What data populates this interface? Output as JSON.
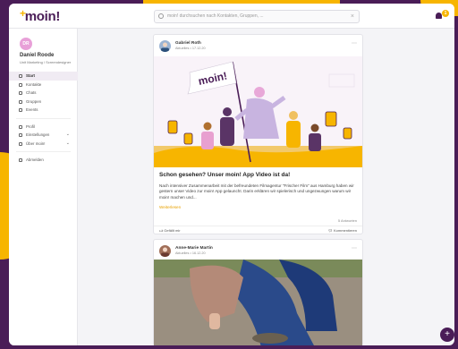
{
  "brand": {
    "logo": "moin!",
    "accent": "#f7b500",
    "primary": "#4a1d57"
  },
  "search": {
    "placeholder": "moin! durchsuchen nach Kontakten, Gruppen, ..."
  },
  "notifications": {
    "count": "1"
  },
  "user": {
    "initials": "DR",
    "name": "Daniel Roode",
    "role": "Unit Marketing / Screendesigner"
  },
  "nav": {
    "start": "Start",
    "kontakte": "Kontakte",
    "chats": "Chats",
    "gruppen": "Gruppen",
    "events": "Events",
    "profil": "Profil",
    "einstellungen": "Einstellungen",
    "ueber": "Über moin!",
    "abmelden": "Abmelden"
  },
  "posts": [
    {
      "author": "Gabriel Roth",
      "meta": "Aktuelles • 17.12.20",
      "title": "Schon gesehen? Unser moin! App Video ist da!",
      "body": "Nach intensiver Zusammenarbeit mit der befreundeten Filmagentur \"Frischer Film\" aus Hamburg haben wir gestern unser Video zur moin! App gelauncht. Darin erklären wir spielerisch und ungezwungen warum wir moin! machen und...",
      "more": "Weiterlesen",
      "answers": "5 Antworten",
      "like": "Gefällt mir",
      "comment": "Kommentieren",
      "flag_text": "moin!"
    },
    {
      "author": "Anne-Marie Martin",
      "meta": "Aktuelles • 16.12.20"
    }
  ],
  "fab": "+"
}
